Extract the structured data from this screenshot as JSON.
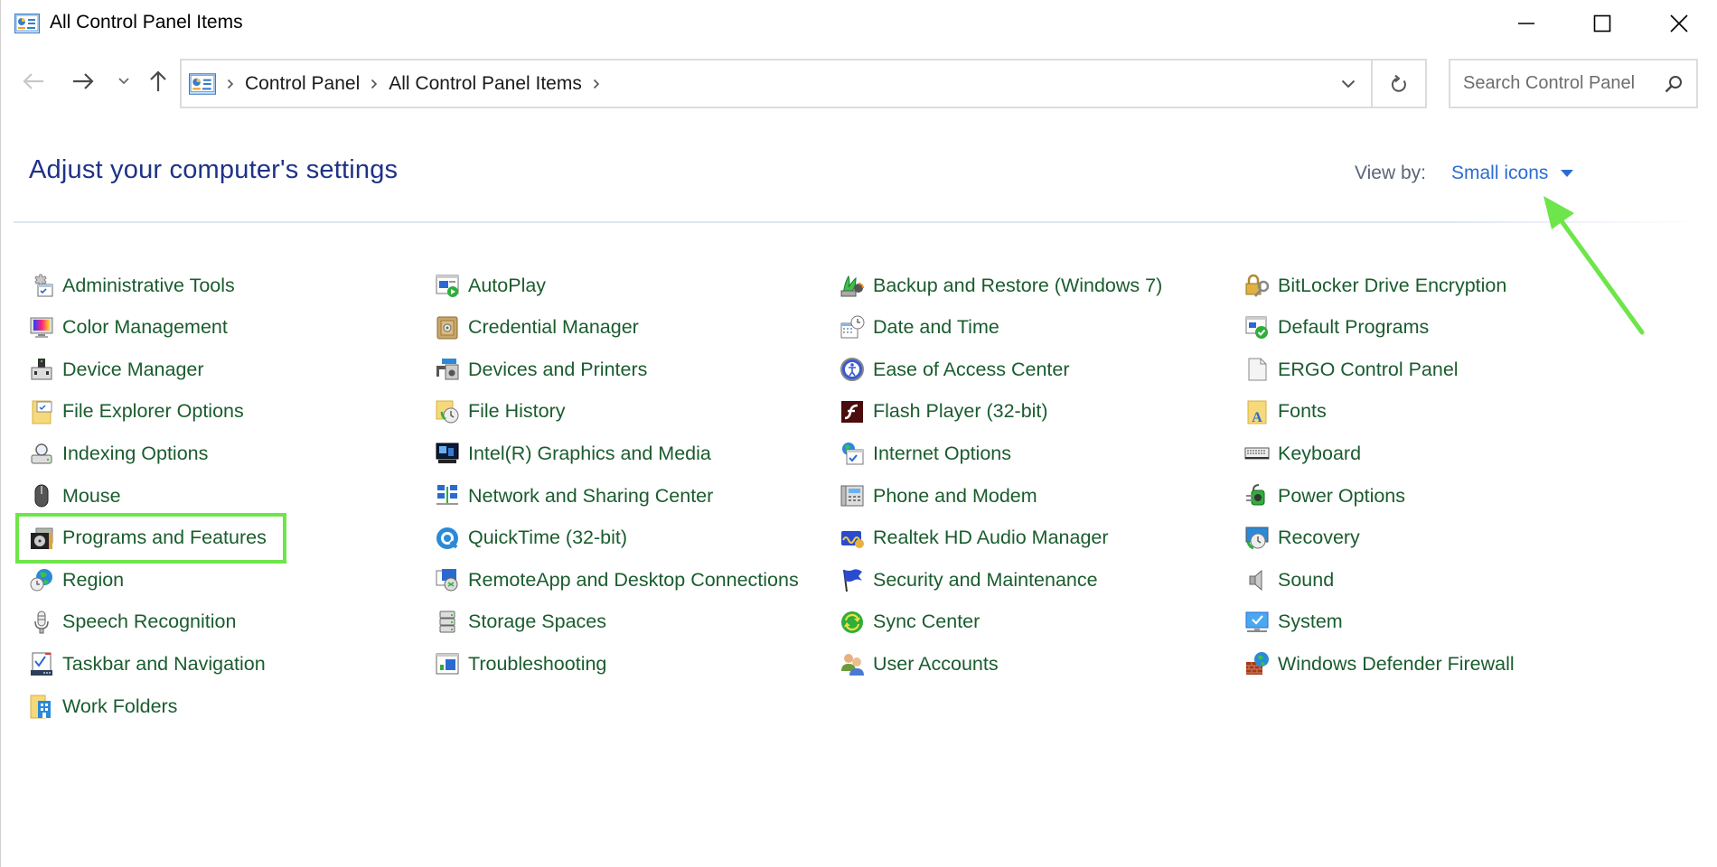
{
  "window": {
    "title": "All Control Panel Items",
    "controls": {
      "minimize": "minimize",
      "maximize": "maximize",
      "close": "close"
    }
  },
  "navigation": {
    "breadcrumb": [
      "Control Panel",
      "All Control Panel Items"
    ],
    "search_placeholder": "Search Control Panel"
  },
  "header": {
    "title": "Adjust your computer's settings",
    "view_by_label": "View by:",
    "view_by_value": "Small icons"
  },
  "columns": [
    {
      "items": [
        {
          "label": "Administrative Tools",
          "icon": "admin-tools-icon"
        },
        {
          "label": "Color Management",
          "icon": "color-management-icon"
        },
        {
          "label": "Device Manager",
          "icon": "device-manager-icon"
        },
        {
          "label": "File Explorer Options",
          "icon": "file-explorer-options-icon"
        },
        {
          "label": "Indexing Options",
          "icon": "indexing-options-icon"
        },
        {
          "label": "Mouse",
          "icon": "mouse-icon"
        },
        {
          "label": "Programs and Features",
          "icon": "programs-features-icon"
        },
        {
          "label": "Region",
          "icon": "region-icon"
        },
        {
          "label": "Speech Recognition",
          "icon": "microphone-icon"
        },
        {
          "label": "Taskbar and Navigation",
          "icon": "taskbar-icon"
        },
        {
          "label": "Work Folders",
          "icon": "work-folders-icon"
        }
      ]
    },
    {
      "items": [
        {
          "label": "AutoPlay",
          "icon": "autoplay-icon"
        },
        {
          "label": "Credential Manager",
          "icon": "credential-manager-icon"
        },
        {
          "label": "Devices and Printers",
          "icon": "devices-printers-icon"
        },
        {
          "label": "File History",
          "icon": "file-history-icon"
        },
        {
          "label": "Intel(R) Graphics and Media",
          "icon": "intel-graphics-icon"
        },
        {
          "label": "Network and Sharing Center",
          "icon": "network-icon"
        },
        {
          "label": "QuickTime (32-bit)",
          "icon": "quicktime-icon"
        },
        {
          "label": "RemoteApp and Desktop Connections",
          "icon": "remoteapp-icon"
        },
        {
          "label": "Storage Spaces",
          "icon": "storage-spaces-icon"
        },
        {
          "label": "Troubleshooting",
          "icon": "troubleshooting-icon"
        }
      ]
    },
    {
      "items": [
        {
          "label": "Backup and Restore (Windows 7)",
          "icon": "backup-restore-icon"
        },
        {
          "label": "Date and Time",
          "icon": "date-time-icon"
        },
        {
          "label": "Ease of Access Center",
          "icon": "ease-of-access-icon"
        },
        {
          "label": "Flash Player (32-bit)",
          "icon": "flash-player-icon"
        },
        {
          "label": "Internet Options",
          "icon": "internet-options-icon"
        },
        {
          "label": "Phone and Modem",
          "icon": "phone-modem-icon"
        },
        {
          "label": "Realtek HD Audio Manager",
          "icon": "realtek-audio-icon"
        },
        {
          "label": "Security and Maintenance",
          "icon": "flag-icon"
        },
        {
          "label": "Sync Center",
          "icon": "sync-center-icon"
        },
        {
          "label": "User Accounts",
          "icon": "user-accounts-icon"
        }
      ]
    },
    {
      "items": [
        {
          "label": "BitLocker Drive Encryption",
          "icon": "bitlocker-icon"
        },
        {
          "label": "Default Programs",
          "icon": "default-programs-icon"
        },
        {
          "label": "ERGO Control Panel",
          "icon": "blank-document-icon"
        },
        {
          "label": "Fonts",
          "icon": "fonts-icon"
        },
        {
          "label": "Keyboard",
          "icon": "keyboard-icon"
        },
        {
          "label": "Power Options",
          "icon": "power-options-icon"
        },
        {
          "label": "Recovery",
          "icon": "recovery-icon"
        },
        {
          "label": "Sound",
          "icon": "speaker-icon"
        },
        {
          "label": "System",
          "icon": "system-icon"
        },
        {
          "label": "Windows Defender Firewall",
          "icon": "firewall-icon"
        }
      ]
    }
  ],
  "annotations": {
    "highlighted_item": "Programs and Features",
    "arrow_target": "Small icons",
    "color": "#6ee54a"
  },
  "colors": {
    "item_label": "#1a5c2e",
    "page_title": "#1e3287",
    "link_blue": "#2b6cd4"
  }
}
